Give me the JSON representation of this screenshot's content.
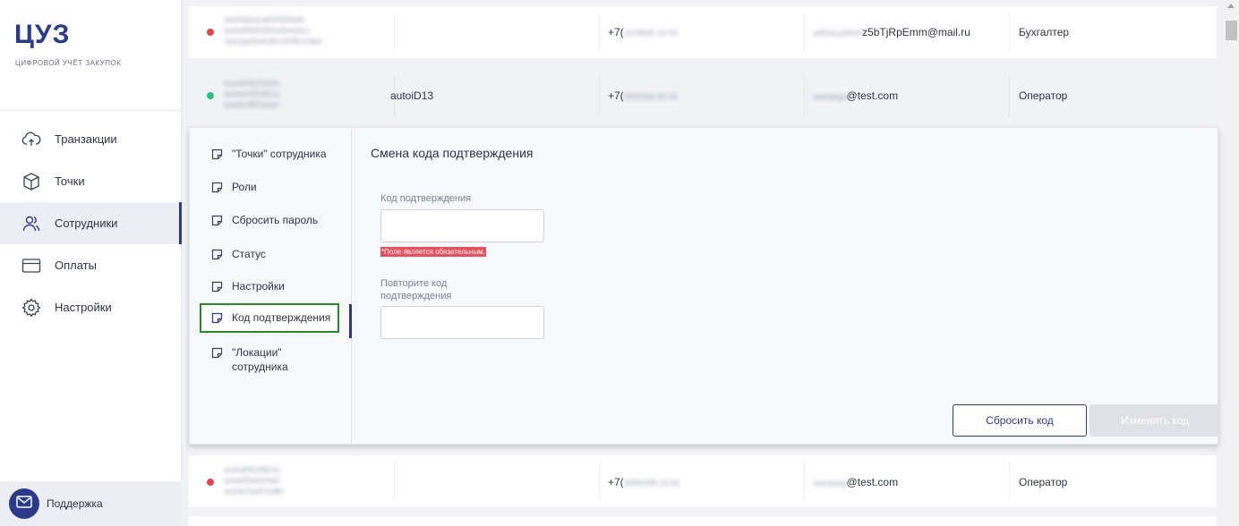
{
  "brand": {
    "logo": "ЦУЗ",
    "subtitle": "ЦИФРОВОЙ УЧЁТ ЗАКУПОК"
  },
  "nav": [
    {
      "label": "Транзакции",
      "icon": "cloud-upload-icon"
    },
    {
      "label": "Точки",
      "icon": "box-icon"
    },
    {
      "label": "Сотрудники",
      "icon": "users-icon",
      "active": true
    },
    {
      "label": "Оплаты",
      "icon": "credit-card-icon"
    },
    {
      "label": "Настройки",
      "icon": "gear-icon"
    }
  ],
  "support": {
    "label": "Поддержка",
    "icon": "mail-icon"
  },
  "rows": [
    {
      "status_color": "#e8434e",
      "name_lines": [
        "ab4f3a2a1ab5f3f2fa9b",
        "kada4f5d52b6a2b4a3c1",
        "1ba1ga2a4a3bc2495c1dea"
      ],
      "login": "",
      "phone_prefix": "+7(",
      "phone_rest": "1978830 10 53",
      "email_prefix": "a4f3a1a2f92b",
      "email_suffix": "z5bTjRpEmm@mail.ru",
      "role": "Бухгалтер"
    },
    {
      "status_color": "#2ec27e",
      "name_lines": [
        "autoaf3b2f1b5a",
        "autokmf2b8b1a",
        "autokcf8f3aasd"
      ],
      "login": "autoiD13",
      "phone_prefix": "+7(",
      "phone_rest": "999456b 55 56",
      "email_prefix": "autoaaga",
      "email_suffix": "@test.com",
      "role": "Оператор"
    },
    {
      "status_color": "#e8434e",
      "name_lines": [
        "autoaf5b2f9b1a",
        "autokf2ab1f4a3",
        "autokc5a2b1a8d"
      ],
      "login": "",
      "phone_prefix": "+7(",
      "phone_rest": "999929f8 16 82",
      "email_prefix": "autoaaag",
      "email_suffix": "@test.com",
      "role": "Оператор"
    }
  ],
  "panel": {
    "menu": [
      {
        "label": "\"Точки\" сотрудника"
      },
      {
        "label": "Роли"
      },
      {
        "label": "Сбросить пароль"
      },
      {
        "label": "Статус"
      },
      {
        "label": "Настройки"
      },
      {
        "label": "Код подтверждения",
        "selected": true
      },
      {
        "label_line1": "\"Локации\"",
        "label_line2": "сотрудника"
      }
    ],
    "form_title": "Смена кода подтверждения",
    "field1_label": "Код подтверждения",
    "field1_value": "",
    "field1_error": "*Поле является обязательным.",
    "field2_label_line1": "Повторите код",
    "field2_label_line2": "подтверждения",
    "field2_value": "",
    "reset_button": "Сбросить код",
    "change_button": "Изменить код"
  },
  "colors": {
    "accent": "#2c3a8c",
    "error": "#e8505b",
    "status_red": "#e8434e",
    "status_green": "#2ec27e",
    "highlight_border": "#2a8a2a"
  }
}
